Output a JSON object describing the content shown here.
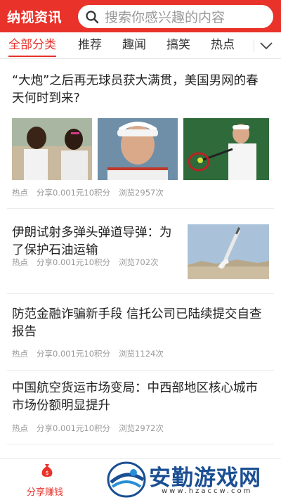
{
  "header": {
    "app_title": "纳视资讯",
    "search_placeholder": "搜索你感兴趣的内容"
  },
  "tabs": [
    {
      "label": "全部分类",
      "active": true
    },
    {
      "label": "推荐",
      "active": false
    },
    {
      "label": "趣闻",
      "active": false
    },
    {
      "label": "搞笑",
      "active": false
    },
    {
      "label": "热点",
      "active": false
    }
  ],
  "articles": [
    {
      "title_line1": "“大炮”之后再无球员获大满贯，美国男网的春",
      "title_line2": "天何时到来?",
      "category": "热点",
      "reward": "分享0.001元10积分",
      "views": "浏览2957次"
    },
    {
      "title_line1": "伊朗试射多弹头弹道导弹：为",
      "title_line2": "了保护石油运输",
      "category": "热点",
      "reward": "分享0.001元10积分",
      "views": "浏览702次"
    },
    {
      "title_line1": "防范金融诈骗新手段 信托公司已陆续提交自查",
      "title_line2": "报告",
      "category": "热点",
      "reward": "分享0.001元10积分",
      "views": "浏览1124次"
    },
    {
      "title_line1": "中国航空货运市场变局：中西部地区核心城市",
      "title_line2": "市场份额明显提升",
      "category": "热点",
      "reward": "分享0.001元10积分",
      "views": "浏览2972次"
    }
  ],
  "bottom_nav": {
    "earn_label": "分享赚钱"
  },
  "watermark": {
    "text": "安勤游戏网",
    "url": "www.hzaccw.com"
  },
  "colors": {
    "brand": "#e8322a",
    "watermark": "#1b4f93"
  }
}
